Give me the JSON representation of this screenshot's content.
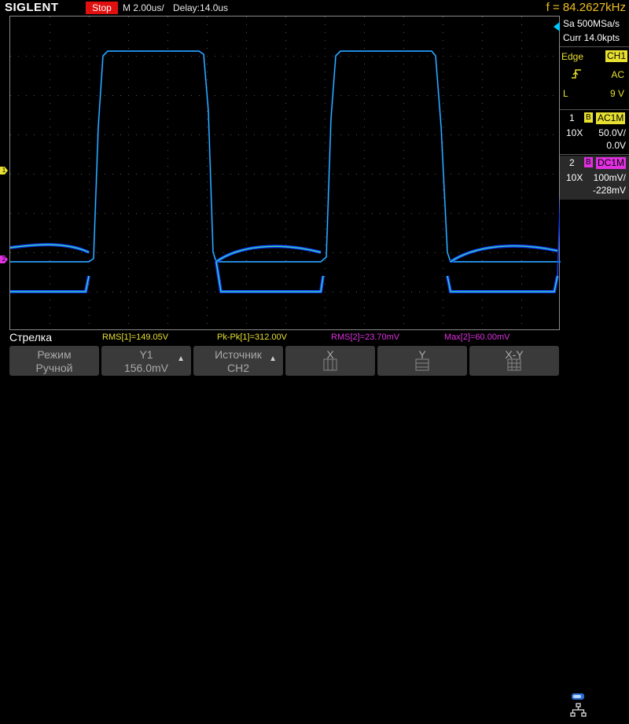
{
  "header": {
    "brand": "SIGLENT",
    "run_state": "Stop",
    "timebase": "M 2.00us/",
    "delay": "Delay:14.0us",
    "frequency": "f = 84.2627kHz"
  },
  "acquisition": {
    "sample_rate": "Sa 500MSa/s",
    "memory": "Curr 14.0kpts"
  },
  "trigger": {
    "type": "Edge",
    "source": "CH1",
    "coupling": "AC",
    "level_label": "L",
    "level_value": "9 V",
    "slope_icon": "rising-edge-icon"
  },
  "channels": [
    {
      "num": "1",
      "bw": "B",
      "coupling": "AC1M",
      "probe": "10X",
      "scale": "50.0V/",
      "offset": "0.0V",
      "color": "#e8e030"
    },
    {
      "num": "2",
      "bw": "B",
      "coupling": "DC1M",
      "probe": "10X",
      "scale": "100mV/",
      "offset": "-228mV",
      "color": "#e030e0"
    }
  ],
  "markers": {
    "ch1": "1",
    "ch2": "2"
  },
  "status_label": "Стрелка",
  "measurements": [
    {
      "text": "RMS[1]=149.05V",
      "color": "#e8e030"
    },
    {
      "text": "Pk-Pk[1]=312.00V",
      "color": "#e8e030"
    },
    {
      "text": "RMS[2]=23.70mV",
      "color": "#e030e0"
    },
    {
      "text": "Max[2]=60.00mV",
      "color": "#e030e0"
    }
  ],
  "softkeys": [
    {
      "line1": "Режим",
      "line2": "Ручной"
    },
    {
      "line1": "Y1",
      "line2": "156.0mV"
    },
    {
      "line1": "Источник",
      "line2": "CH2"
    },
    {
      "line1": "X",
      "line2": ""
    },
    {
      "line1": "Y",
      "line2": ""
    },
    {
      "line1": "X-Y",
      "line2": ""
    }
  ],
  "colors": {
    "ch1": "#e8e030",
    "ch2": "#e030e0",
    "trace": "#1040ff",
    "freq": "#f0c020"
  }
}
